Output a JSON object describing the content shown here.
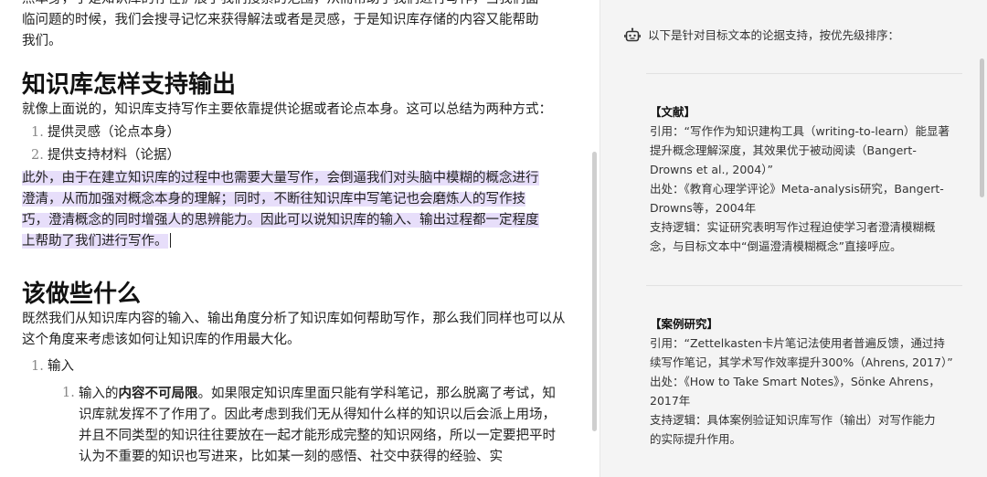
{
  "doc": {
    "intro_lines": [
      "点本身，于是知识库的存在扩展了我们搜索的范围，从而帮助了我们进行写作，当我们面",
      "临问题的时候，我们会搜寻记忆来获得解法或者是灵感，于是知识库存储的内容又能帮助",
      "我们。"
    ],
    "heading1": "知识库怎样支持输出",
    "para1": "就像上面说的，知识库支持写作主要依靠提供论据或者论点本身。这可以总结为两种方式：",
    "list1": [
      {
        "num": "1.",
        "text": "提供灵感（论点本身）"
      },
      {
        "num": "2.",
        "text": "提供支持材料（论据）"
      }
    ],
    "highlight_lines": [
      "此外，由于在建立知识库的过程中也需要大量写作，会倒逼我们对头脑中模糊的概念进行",
      "澄清，从而加强对概念本身的理解；同时，不断往知识库中写笔记也会磨炼人的写作技",
      "巧，澄清概念的同时增强人的思辨能力。因此可以说知识库的输入、输出过程都一定程度",
      "上帮助了我们进行写作。"
    ],
    "heading2": "该做些什么",
    "para2": "既然我们从知识库内容的输入、输出角度分析了知识库如何帮助写作，那么我们同样也可以从这个角度来考虑该如何让知识库的作用最大化。",
    "list2_num": "1.",
    "list2_label": "输入",
    "list3_num": "1.",
    "list3_prefix": "输入的",
    "list3_bold": "内容不可局限",
    "list3_text": "。如果限定知识库里面只能有学科笔记，那么脱离了考试，知识库就发挥不了作用了。因此考虑到我们无从得知什么样的知识以后会派上用场，并且不同类型的知识往往要放在一起才能形成完整的知识网络，所以一定要把平时认为不重要的知识也写进来，比如某一刻的感悟、社交中获得的经验、实"
  },
  "panel": {
    "intro": "以下是针对目标文本的论据支持，按优先级排序：",
    "icon": "robot-icon",
    "cards": [
      {
        "tag": "【文献】",
        "lines": [
          "引用：“写作作为知识建构工具（writing-to-learn）能显著",
          "提升概念理解深度，其效果优于被动阅读（Bangert-",
          "Drowns et al., 2004）”",
          "出处：《教育心理学评论》Meta-analysis研究，Bangert-",
          "Drowns等，2004年",
          "支持逻辑：实证研究表明写作过程迫使学习者澄清模糊概",
          "念，与目标文本中“倒逼澄清模糊概念”直接呼应。"
        ]
      },
      {
        "tag": "【案例研究】",
        "lines": [
          "引用：“Zettelkasten卡片笔记法使用者普遍反馈，通过持",
          "续写作笔记，其学术写作效率提升300%（Ahrens, 2017）”",
          "出处：《How to Take Smart Notes》，Sönke Ahrens，",
          "2017年",
          "支持逻辑：具体案例验证知识库写作（输出）对写作能力",
          "的实际提升作用。"
        ]
      }
    ]
  },
  "colors": {
    "highlight": "#e7defa",
    "panel_bg": "#f4f4f4"
  }
}
